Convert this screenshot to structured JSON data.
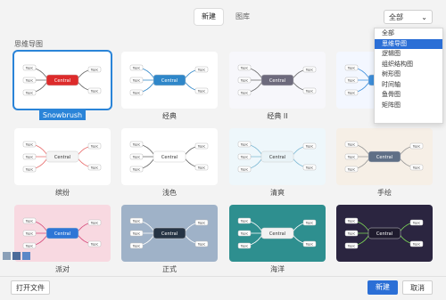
{
  "tabs": [
    {
      "label": "新建",
      "active": true
    },
    {
      "label": "图库",
      "active": false
    }
  ],
  "filter": {
    "selected": "全部",
    "options": [
      "全部",
      "思维导图",
      "逻辑图",
      "组织结构图",
      "树形图",
      "时间轴",
      "鱼骨图",
      "矩阵图"
    ],
    "active_index": 1
  },
  "section_title": "思维导图",
  "cards": [
    {
      "label": "Snowbrush",
      "selected": true,
      "bg": "#ffffff"
    },
    {
      "label": "经典",
      "selected": false,
      "bg": "#ffffff"
    },
    {
      "label": "经典 II",
      "selected": false,
      "bg": "#f7f7fb"
    },
    {
      "label": "",
      "selected": false,
      "bg": "#f3f7ff"
    },
    {
      "label": "缤纷",
      "selected": false,
      "bg": "#ffffff"
    },
    {
      "label": "浅色",
      "selected": false,
      "bg": "#ffffff"
    },
    {
      "label": "清爽",
      "selected": false,
      "bg": "#eef7fb"
    },
    {
      "label": "手绘",
      "selected": false,
      "bg": "#f6efe6"
    },
    {
      "label": "派对",
      "selected": false,
      "bg": "#f8d9e1"
    },
    {
      "label": "正式",
      "selected": false,
      "bg": "#9fb2c8"
    },
    {
      "label": "海洋",
      "selected": false,
      "bg": "#2e8f8f"
    },
    {
      "label": "",
      "selected": false,
      "bg": "#2b2540"
    }
  ],
  "buttons": {
    "open_file": "打开文件",
    "new": "新建",
    "cancel": "取消"
  },
  "node_labels": {
    "topic": "Topic",
    "central": "Central"
  },
  "colors": {
    "accent": "#2b6fd6",
    "selected_border": "#2a84d8"
  }
}
